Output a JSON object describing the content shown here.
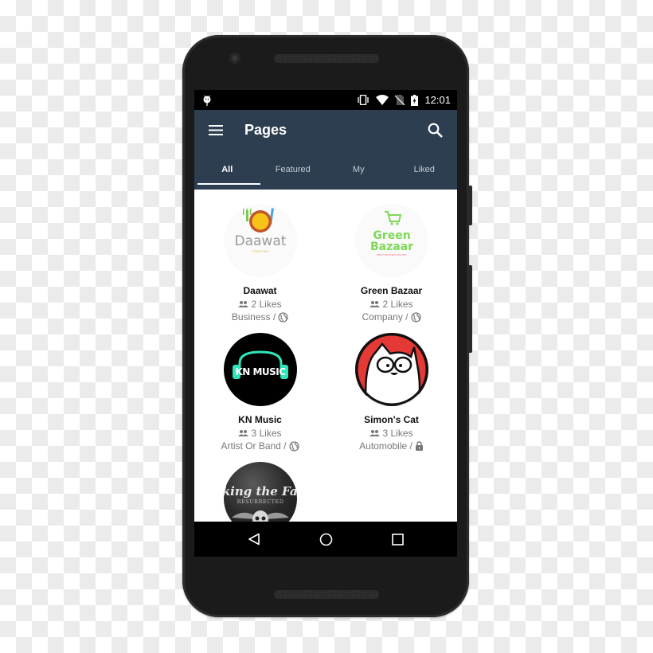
{
  "status_bar": {
    "time": "12:01",
    "icons": [
      "android-debug-icon",
      "vibrate-icon",
      "wifi-icon",
      "no-sim-icon",
      "battery-charging-icon"
    ]
  },
  "app_bar": {
    "menu_icon": "hamburger-menu-icon",
    "title": "Pages",
    "search_icon": "search-icon"
  },
  "tabs": [
    {
      "label": "All",
      "active": true
    },
    {
      "label": "Featured",
      "active": false
    },
    {
      "label": "My",
      "active": false
    },
    {
      "label": "Liked",
      "active": false
    }
  ],
  "pages": [
    {
      "name": "Daawat",
      "likes": "2 Likes",
      "category": "Business /",
      "privacy_icon": "globe-icon",
      "logo_text": "Daawat",
      "logo_subtext": "FOOD CAFE"
    },
    {
      "name": "Green Bazaar",
      "likes": "2 Likes",
      "category": "Company /",
      "privacy_icon": "globe-icon",
      "logo_text_1": "Green",
      "logo_text_2": "Bazaar",
      "logo_subtext": "FRESH GROCERIES DELIVERY"
    },
    {
      "name": "KN Music",
      "likes": "3 Likes",
      "category": "Artist Or Band /",
      "privacy_icon": "globe-icon",
      "logo_text": "KN MUSIC"
    },
    {
      "name": "Simon's Cat",
      "likes": "3 Likes",
      "category": "Automobile /",
      "privacy_icon": "lock-icon"
    },
    {
      "logo_text": "aking the Fall",
      "logo_subtext": "RESURRECTED"
    }
  ],
  "nav_bar": {
    "back": "back-icon",
    "home": "home-icon",
    "recents": "recents-icon"
  },
  "colors": {
    "app_bar": "#2d3e50",
    "status_bar": "#000000",
    "green_bazaar": "#7ed957",
    "kn_music_accent": "#2ee6b8",
    "simons_cat_red": "#e53935"
  }
}
